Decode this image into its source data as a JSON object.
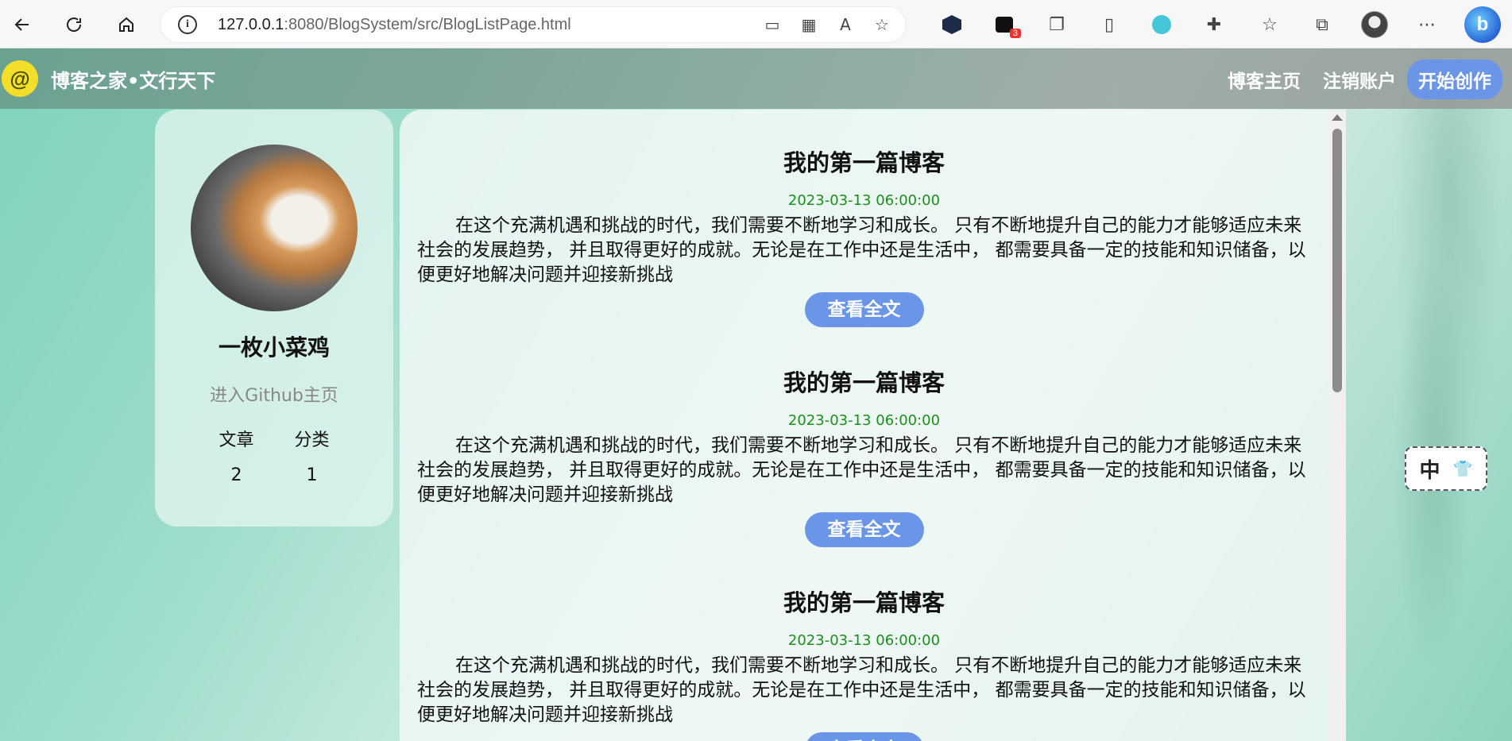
{
  "browser": {
    "url_host": "127.0.0.1",
    "url_rest": ":8080/BlogSystem/src/BlogListPage.html",
    "ext_badge": "3"
  },
  "site": {
    "logo_glyph": "@",
    "title": "博客之家•文行天下",
    "nav": {
      "home": "博客主页",
      "logout": "注销账户",
      "create": "开始创作"
    }
  },
  "profile": {
    "name": "一枚小菜鸡",
    "github_link": "进入Github主页",
    "stats_labels": [
      "文章",
      "分类"
    ],
    "stats_values": [
      "2",
      "1"
    ]
  },
  "blogs": [
    {
      "title": "我的第一篇博客",
      "date": "2023-03-13 06:00:00",
      "desc": "在这个充满机遇和挑战的时代，我们需要不断地学习和成长。 只有不断地提升自己的能力才能够适应未来社会的发展趋势， 并且取得更好的成就。无论是在工作中还是生活中， 都需要具备一定的技能和知识储备，以便更好地解决问题并迎接新挑战",
      "button": "查看全文"
    },
    {
      "title": "我的第一篇博客",
      "date": "2023-03-13 06:00:00",
      "desc": "在这个充满机遇和挑战的时代，我们需要不断地学习和成长。 只有不断地提升自己的能力才能够适应未来社会的发展趋势， 并且取得更好的成就。无论是在工作中还是生活中， 都需要具备一定的技能和知识储备，以便更好地解决问题并迎接新挑战",
      "button": "查看全文"
    },
    {
      "title": "我的第一篇博客",
      "date": "2023-03-13 06:00:00",
      "desc": "在这个充满机遇和挑战的时代，我们需要不断地学习和成长。 只有不断地提升自己的能力才能够适应未来社会的发展趋势， 并且取得更好的成就。无论是在工作中还是生活中， 都需要具备一定的技能和知识储备，以便更好地解决问题并迎接新挑战",
      "button": "查看全文"
    }
  ],
  "ime": {
    "lang": "中",
    "skin_icon": "👕"
  },
  "colors": {
    "accent": "#6b96e8",
    "date": "#1a8f1a"
  }
}
